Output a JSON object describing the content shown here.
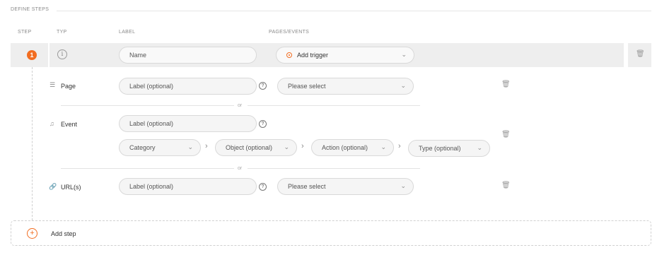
{
  "section": {
    "title": "DEFINE STEPS"
  },
  "columns": {
    "step": "STEP",
    "typ": "TYP",
    "label": "LABEL",
    "pages_events": "PAGES/EVENTS"
  },
  "step": {
    "number": "1",
    "name_placeholder": "Name",
    "trigger_label": "Add trigger"
  },
  "page_row": {
    "label": "Page",
    "label_placeholder": "Label (optional)",
    "select_value": "Please select"
  },
  "separator": {
    "or": "or"
  },
  "event_row": {
    "label": "Event",
    "label_placeholder": "Label (optional)",
    "category": "Category",
    "object": "Object (optional)",
    "action": "Action (optional)",
    "type": "Type (optional)"
  },
  "url_row": {
    "label": "URL(s)",
    "label_placeholder": "Label (optional)",
    "select_value": "Please select"
  },
  "add_step": {
    "label": "Add step"
  },
  "icons": {
    "info": "info-icon",
    "page": "page-icon",
    "event": "event-icon",
    "url": "link-icon",
    "trash": "trash-icon",
    "help": "help-icon",
    "add": "plus-circle-icon",
    "chevron": "chevron-down-icon"
  },
  "colors": {
    "accent": "#f26d21",
    "bar": "#eeeeee",
    "border": "#d9d9d9"
  }
}
